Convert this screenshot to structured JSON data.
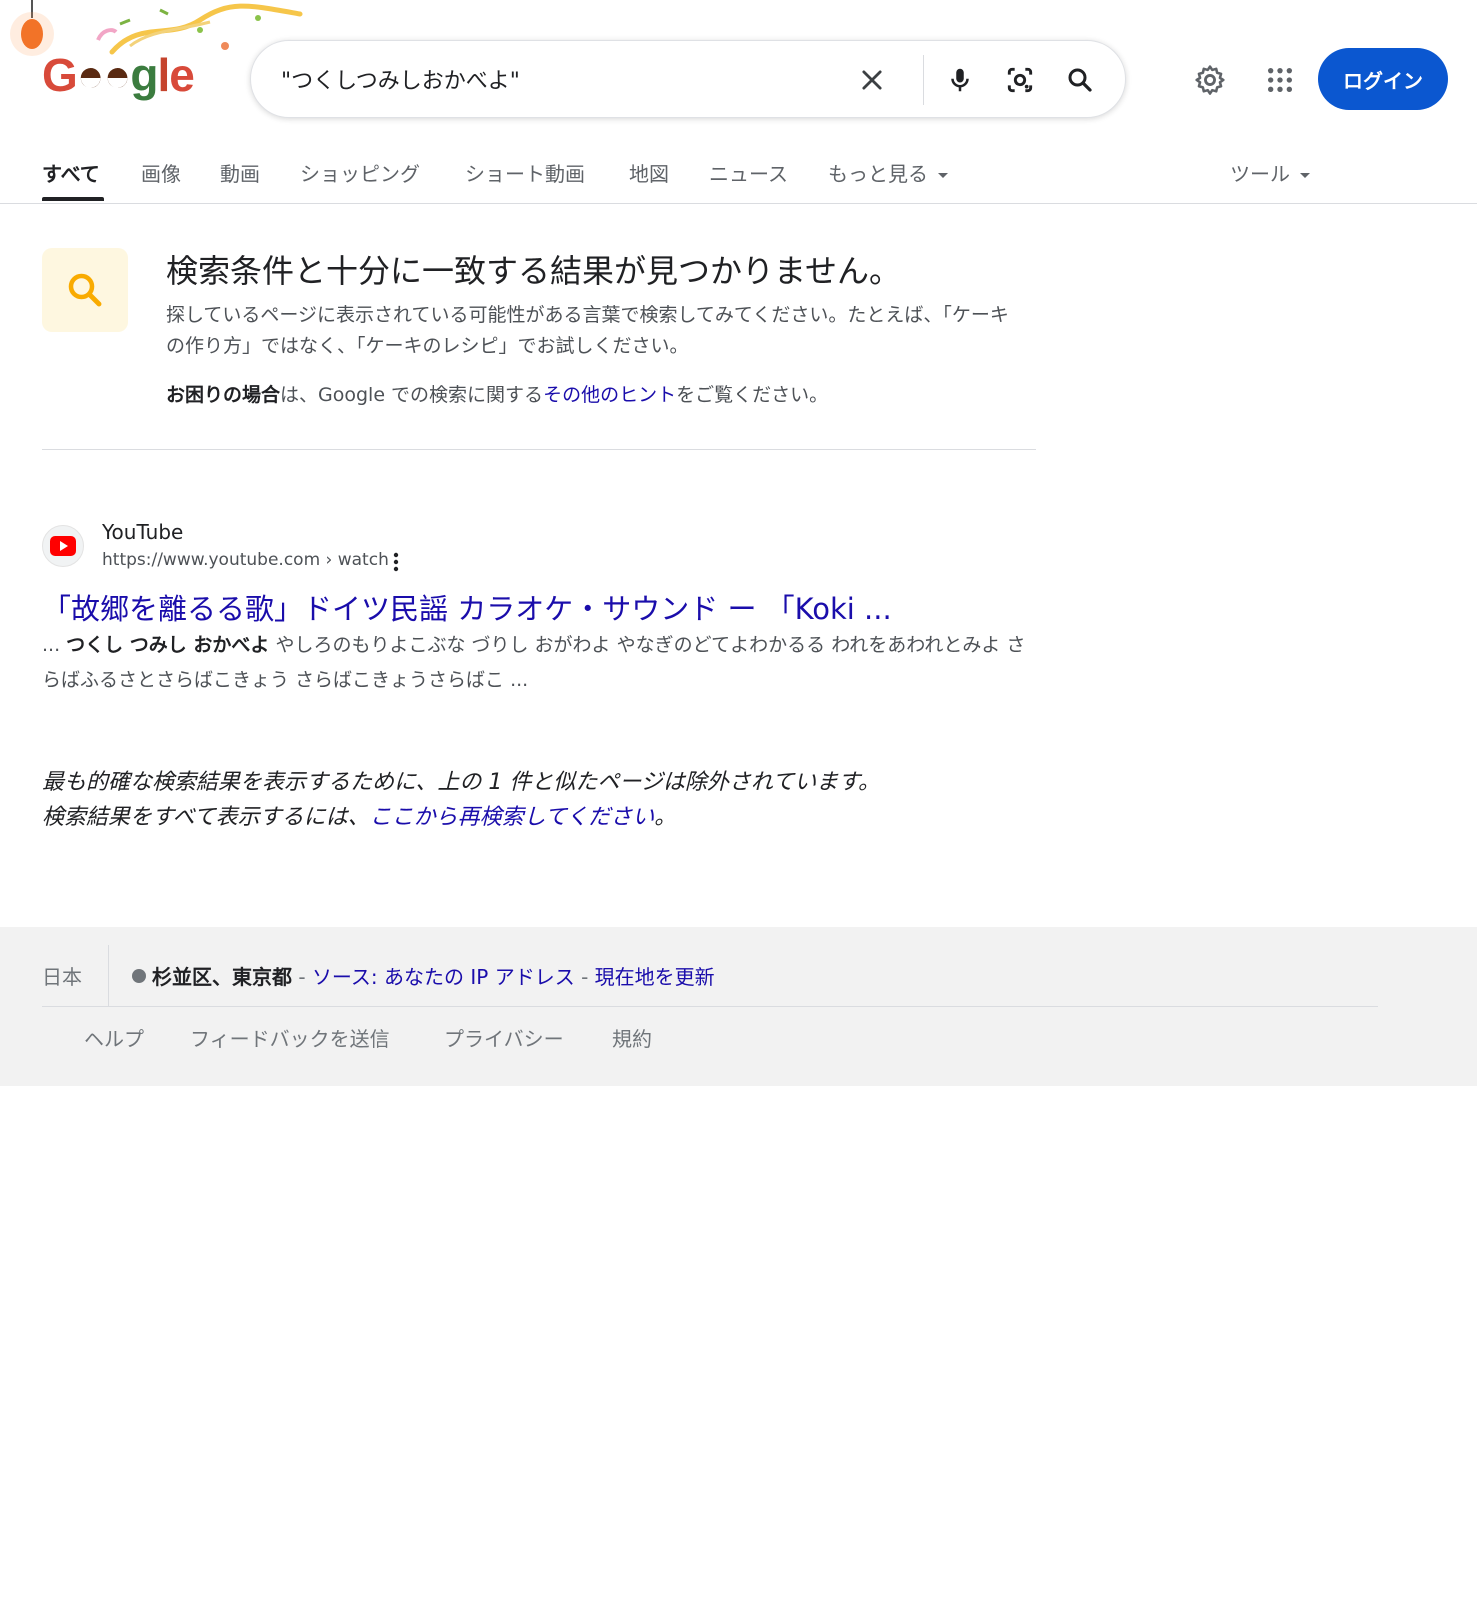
{
  "header": {
    "logo_text": "Google",
    "search_value": "\"つくしつみしおかべよ\"",
    "login_label": "ログイン"
  },
  "tabs": [
    {
      "label": "すべて"
    },
    {
      "label": "画像"
    },
    {
      "label": "動画"
    },
    {
      "label": "ショッピング"
    },
    {
      "label": "ショート動画"
    },
    {
      "label": "地図"
    },
    {
      "label": "ニュース"
    },
    {
      "label": "もっと見る"
    }
  ],
  "tools_label": "ツール",
  "no_results": {
    "title": "検索条件と十分に一致する結果が見つかりません。",
    "desc": "探しているページに表示されている可能性がある言葉で検索してみてください。たとえば、「ケーキの作り方」ではなく、「ケーキのレシピ」でお試しください。",
    "hint_bold": "お困りの場合",
    "hint_pre": "は、Google での検索に関する",
    "hint_link": "その他のヒント",
    "hint_post": "をご覧ください。"
  },
  "result": {
    "site_name": "YouTube",
    "url": "https://www.youtube.com › watch",
    "title": "「故郷を離るる歌」ドイツ民謡 カラオケ・サウンド ー 「Koki ...",
    "snippet_pre": "... ",
    "snippet_bold": "つくし つみし おかべよ",
    "snippet_post": " やしろのもりよこぶな づりし おがわよ やなぎのどてよわかるる われをあわれとみよ さらばふるさとさらばこきょう さらばこきょうさらばこ ..."
  },
  "omitted": {
    "line1": "最も的確な検索結果を表示するために、上の 1 件と似たページは除外されています。",
    "line2_pre": "検索結果をすべて表示するには、",
    "line2_link": "ここから再検索してください",
    "line2_post": "。"
  },
  "footer": {
    "country": "日本",
    "location": "杉並区、東京都",
    "sep1": " - ",
    "source": "ソース: あなたの IP アドレス",
    "sep2": " - ",
    "update": "現在地を更新",
    "links": [
      "ヘルプ",
      "フィードバックを送信",
      "プライバシー",
      "規約"
    ]
  },
  "colors": {
    "accent": "#0b57d0",
    "link": "#1a0dab",
    "text": "#202124",
    "muted": "#4d5156",
    "footer_bg": "#f2f2f2"
  }
}
